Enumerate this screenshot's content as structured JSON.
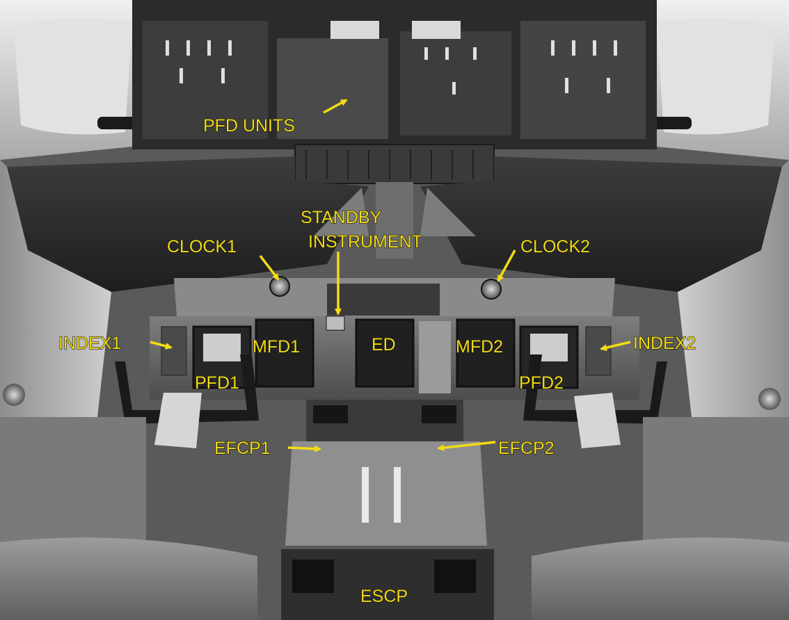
{
  "colors": {
    "label": "#f2dc14",
    "panel_dark": "#1c1c1c",
    "panel_mid": "#6a6a6a",
    "panel_light": "#c8c8c8",
    "frame_white": "#e6e6e6"
  },
  "labels": {
    "pfd_units": "PFD UNITS",
    "standby_line1": "STANDBY",
    "standby_line2": "INSTRUMENT",
    "clock1": "CLOCK1",
    "clock2": "CLOCK2",
    "index1": "INDEX1",
    "index2": "INDEX2",
    "mfd1": "MFD1",
    "mfd2": "MFD2",
    "ed": "ED",
    "pfd1": "PFD1",
    "pfd2": "PFD2",
    "efcp1": "EFCP1",
    "efcp2": "EFCP2",
    "escp": "ESCP"
  }
}
